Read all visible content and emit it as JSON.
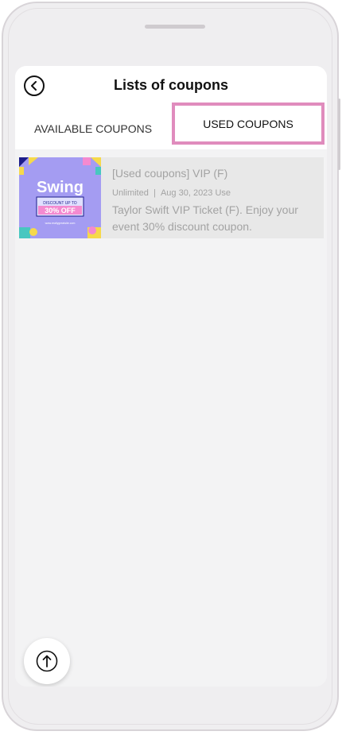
{
  "header": {
    "title": "Lists of coupons",
    "back_icon": "chevron-left-icon"
  },
  "tabs": [
    {
      "label": "AVAILABLE COUPONS",
      "selected": false
    },
    {
      "label": "USED COUPONS",
      "selected": true
    }
  ],
  "coupons": [
    {
      "title": "[Used coupons] VIP (F)",
      "usage": "Unlimited",
      "separator": "|",
      "date": "Aug 30, 2023 Use",
      "description": "Taylor Swift VIP Ticket (F). Enjoy your event 30% discount coupon.",
      "image": {
        "headline": "Swing",
        "subtext": "DISCOUNT UP TO",
        "offer": "30% OFF",
        "footer": "www.reallygreatsite.com"
      }
    }
  ],
  "fab": {
    "icon": "arrow-up-icon"
  },
  "colors": {
    "highlight": "#e08cbd",
    "thumb_bg": "#a49cf2",
    "muted_text": "#a3a3a3"
  }
}
